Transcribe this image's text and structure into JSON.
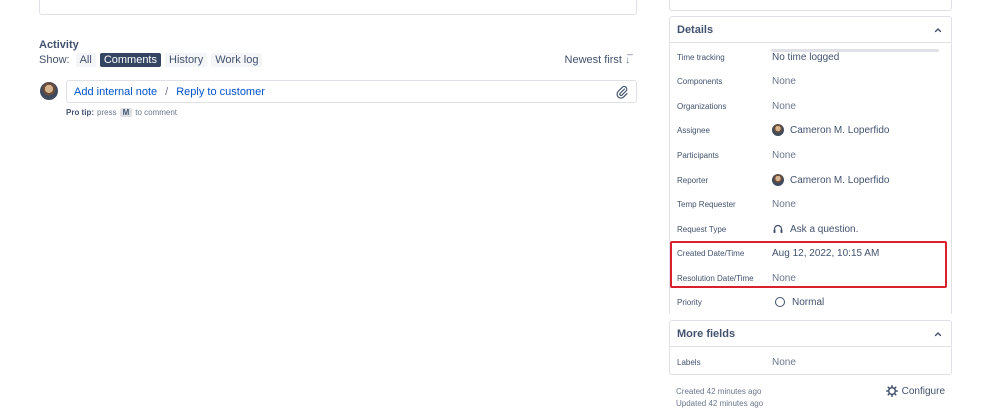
{
  "activity": {
    "title": "Activity",
    "show_label": "Show:",
    "filters": [
      "All",
      "Comments",
      "History",
      "Work log"
    ],
    "active_filter": "Comments",
    "sort_label": "Newest first",
    "sort_icon": "sort-descending-icon"
  },
  "comment": {
    "add_internal_note": "Add internal note",
    "separator": "/",
    "reply_to_customer": "Reply to customer",
    "attach_icon": "paperclip-icon"
  },
  "protip": {
    "label": "Pro tip:",
    "text_before": "press",
    "key": "M",
    "text_after": "to comment"
  },
  "details": {
    "title": "Details",
    "fields": [
      {
        "label": "Time tracking",
        "value": "No time logged"
      },
      {
        "label": "Components",
        "value": "None"
      },
      {
        "label": "Organizations",
        "value": "None"
      },
      {
        "label": "Assignee",
        "value": "Cameron M. Loperfido"
      },
      {
        "label": "Participants",
        "value": "None"
      },
      {
        "label": "Reporter",
        "value": "Cameron M. Loperfido"
      },
      {
        "label": "Temp Requester",
        "value": "None"
      },
      {
        "label": "Request Type",
        "value": "Ask a question."
      },
      {
        "label": "Created Date/Time",
        "value": "Aug 12, 2022, 10:15 AM"
      },
      {
        "label": "Resolution Date/Time",
        "value": "None"
      },
      {
        "label": "Priority",
        "value": "Normal"
      }
    ]
  },
  "more_fields": {
    "title": "More fields",
    "fields": [
      {
        "label": "Labels",
        "value": "None"
      }
    ]
  },
  "meta": {
    "created": "Created 42 minutes ago",
    "updated": "Updated 42 minutes ago",
    "configure": "Configure"
  },
  "colors": {
    "accent": "#0052cc",
    "active_filter_bg": "#344563",
    "highlight": "#d9202c"
  }
}
